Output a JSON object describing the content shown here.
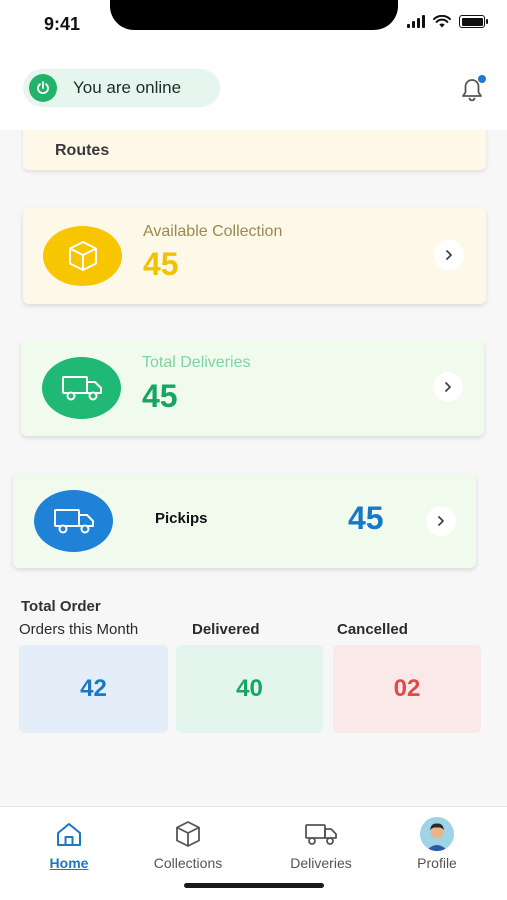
{
  "status_bar": {
    "time": "9:41"
  },
  "header": {
    "online_status": "You are online",
    "notification_dot_color": "#1e7ad4"
  },
  "routes_card": {
    "label": "Routes"
  },
  "cards": {
    "available_collection": {
      "label": "Available Collection",
      "value": "45",
      "accent": "#f7c600"
    },
    "total_deliveries": {
      "label": "Total Deliveries",
      "value": "45",
      "accent": "#1fb874"
    },
    "pickups": {
      "label": "Pickips",
      "value": "45",
      "accent": "#1f82d6"
    }
  },
  "summary": {
    "title": "Total Order",
    "month_label": "Orders this Month",
    "delivered_label": "Delivered",
    "cancelled_label": "Cancelled",
    "month_value": "42",
    "delivered_value": "40",
    "cancelled_value": "02"
  },
  "tabbar": {
    "home": "Home",
    "collections": "Collections",
    "deliveries": "Deliveries",
    "profile": "Profile",
    "active": "Home"
  }
}
